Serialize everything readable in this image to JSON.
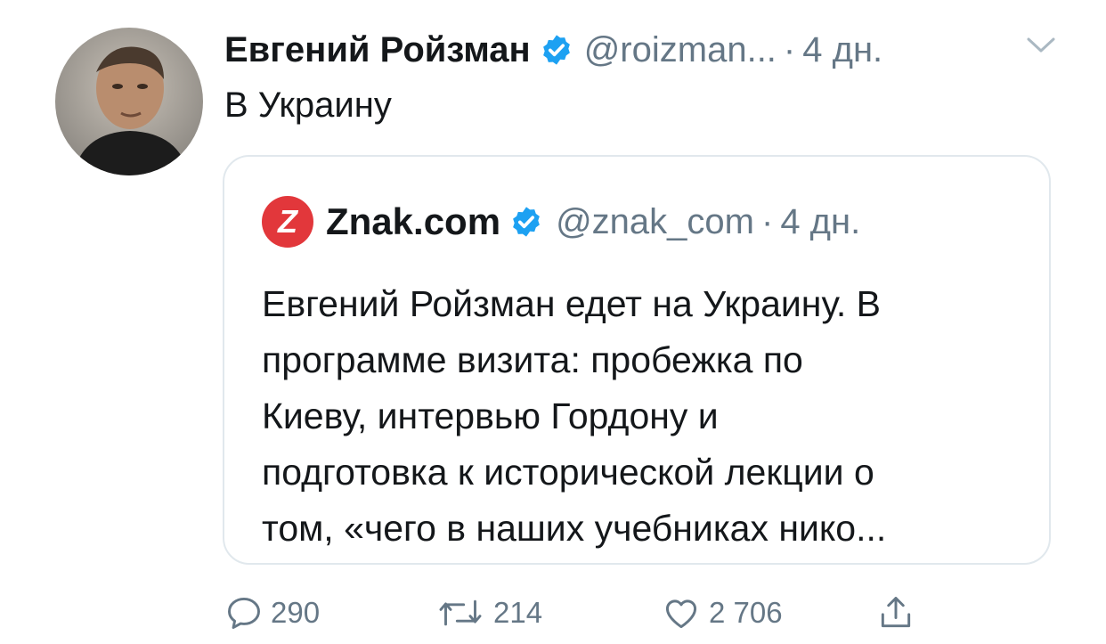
{
  "tweet": {
    "author_name": "Евгений Ройзман",
    "handle": "@roizman...",
    "separator": "·",
    "time": "4 дн.",
    "text": "В Украину"
  },
  "quoted_tweet": {
    "logo_letter": "Z",
    "author_name": "Znak.com",
    "handle": "@znak_com",
    "separator": "·",
    "time": "4 дн.",
    "text_lines": [
      "Евгений Ройзман едет на Украину. В",
      "программе визита: пробежка по",
      "Киеву, интервью Гордону и",
      "подготовка к исторической лекции о",
      "том, «чего в наших учебниках нико..."
    ]
  },
  "actions": {
    "replies": "290",
    "retweets": "214",
    "likes": "2 706"
  },
  "colors": {
    "text": "#14171a",
    "secondary": "#657786",
    "verified": "#1da1f2",
    "border": "#e1e8ed",
    "znak_red": "#e2373b"
  },
  "icons": [
    "avatar",
    "verified-badge-icon",
    "chevron-down-icon",
    "znak-logo",
    "reply-icon",
    "retweet-icon",
    "like-icon",
    "share-icon"
  ]
}
